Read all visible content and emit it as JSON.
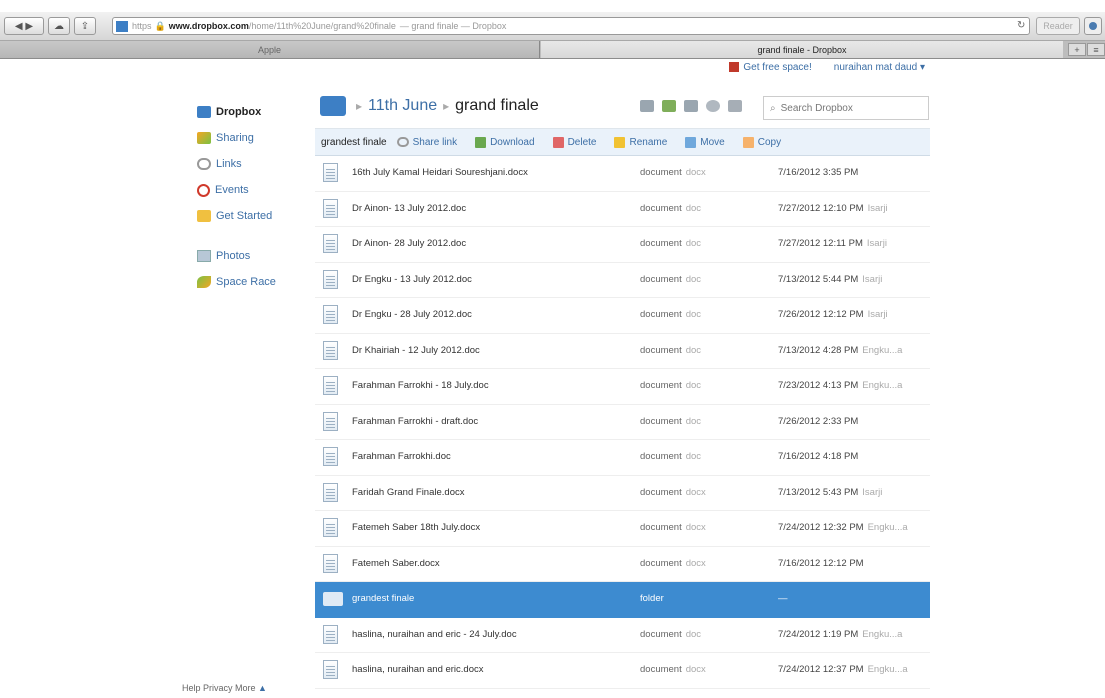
{
  "browser": {
    "url_scheme": "https",
    "url_host": "www.dropbox.com",
    "url_path": "/home/11th%20June/grand%20finale",
    "url_title": "— grand finale — Dropbox",
    "reader_label": "Reader",
    "tabs": [
      {
        "label": "Apple"
      },
      {
        "label": "grand finale - Dropbox"
      }
    ]
  },
  "topbar": {
    "free_space": "Get free space!",
    "user": "nuraihan mat daud"
  },
  "sidebar": {
    "items": [
      {
        "label": "Dropbox",
        "icon": "dropbox-icon"
      },
      {
        "label": "Sharing",
        "icon": "sharing-icon"
      },
      {
        "label": "Links",
        "icon": "links-icon"
      },
      {
        "label": "Events",
        "icon": "events-icon"
      },
      {
        "label": "Get Started",
        "icon": "get-started-icon"
      },
      {
        "label": "Photos",
        "icon": "photos-icon"
      },
      {
        "label": "Space Race",
        "icon": "space-race-icon"
      }
    ]
  },
  "footer": "Help Privacy More",
  "breadcrumb": {
    "parent": "11th June",
    "current": "grand finale"
  },
  "search": {
    "placeholder": "Search Dropbox"
  },
  "actionbar": {
    "selected": "grandest finale",
    "share": "Share link",
    "download": "Download",
    "delete": "Delete",
    "rename": "Rename",
    "move": "Move",
    "copy": "Copy"
  },
  "files": [
    {
      "name": "16th July Kamal Heidari Soureshjani.docx",
      "kind": "document",
      "ext": "docx",
      "date": "7/16/2012 3:35 PM",
      "by": ""
    },
    {
      "name": "Dr Ainon- 13 July 2012.doc",
      "kind": "document",
      "ext": "doc",
      "date": "7/27/2012 12:10 PM",
      "by": "Isarji"
    },
    {
      "name": "Dr Ainon- 28 July 2012.doc",
      "kind": "document",
      "ext": "doc",
      "date": "7/27/2012 12:11 PM",
      "by": "Isarji"
    },
    {
      "name": "Dr Engku - 13 July 2012.doc",
      "kind": "document",
      "ext": "doc",
      "date": "7/13/2012 5:44 PM",
      "by": "Isarji"
    },
    {
      "name": "Dr Engku - 28 July 2012.doc",
      "kind": "document",
      "ext": "doc",
      "date": "7/26/2012 12:12 PM",
      "by": "Isarji"
    },
    {
      "name": "Dr Khairiah - 12 July 2012.doc",
      "kind": "document",
      "ext": "doc",
      "date": "7/13/2012 4:28 PM",
      "by": "Engku...a"
    },
    {
      "name": "Farahman Farrokhi - 18 July.doc",
      "kind": "document",
      "ext": "doc",
      "date": "7/23/2012 4:13 PM",
      "by": "Engku...a"
    },
    {
      "name": "Farahman Farrokhi - draft.doc",
      "kind": "document",
      "ext": "doc",
      "date": "7/26/2012 2:33 PM",
      "by": ""
    },
    {
      "name": "Farahman Farrokhi.doc",
      "kind": "document",
      "ext": "doc",
      "date": "7/16/2012 4:18 PM",
      "by": ""
    },
    {
      "name": "Faridah Grand Finale.docx",
      "kind": "document",
      "ext": "docx",
      "date": "7/13/2012 5:43 PM",
      "by": "Isarji"
    },
    {
      "name": "Fatemeh Saber 18th July.docx",
      "kind": "document",
      "ext": "docx",
      "date": "7/24/2012 12:32 PM",
      "by": "Engku...a"
    },
    {
      "name": "Fatemeh Saber.docx",
      "kind": "document",
      "ext": "docx",
      "date": "7/16/2012 12:12 PM",
      "by": ""
    },
    {
      "name": "grandest finale",
      "kind": "folder",
      "ext": "",
      "date": "—",
      "by": "",
      "selected": true
    },
    {
      "name": "haslina, nuraihan and eric - 24 July.doc",
      "kind": "document",
      "ext": "doc",
      "date": "7/24/2012 1:19 PM",
      "by": "Engku...a"
    },
    {
      "name": "haslina, nuraihan and eric.docx",
      "kind": "document",
      "ext": "docx",
      "date": "7/24/2012 12:37 PM",
      "by": "Engku...a"
    }
  ]
}
